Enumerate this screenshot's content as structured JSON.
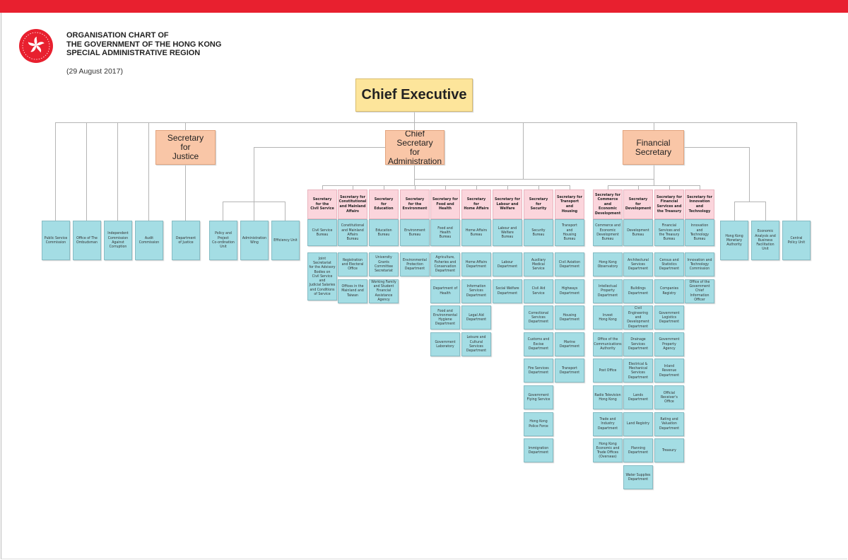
{
  "header": {
    "title_lines": [
      "ORGANISATION CHART OF",
      "THE GOVERNMENT OF THE HONG KONG",
      "SPECIAL ADMINISTRATIVE REGION"
    ],
    "date": "(29 August 2017)",
    "logo_text": "HONG KONG"
  },
  "colors": {
    "top_bar": "#e8202f",
    "chief_executive": "#fde59b",
    "principal_officials": "#f9c6a7",
    "secretaries": "#fbd5dc",
    "departments": "#a4dde4"
  },
  "chief_executive": "Chief Executive",
  "principal_officials": {
    "sj": "Secretary\nfor\nJustice",
    "cs": "Chief Secretary\nfor\nAdministration",
    "fs": "Financial\nSecretary"
  },
  "independent": [
    "Public Service\nCommission",
    "Office of The\nOmbudsman",
    "Independent\nCommission\nAgainst\nCorruption",
    "Audit\nCommission"
  ],
  "sj_units": [
    "Department\nof Justice"
  ],
  "cs_units": [
    "Policy and\nProject\nCo-ordination\nUnit",
    "Administration\nWing",
    "Efficiency Unit"
  ],
  "fs_units": [
    "Hong Kong\nMonetary\nAuthority",
    "Economic\nAnalysis and\nBusiness\nFacilitation Unit"
  ],
  "ce_units": [
    "Central\nPolicy Unit"
  ],
  "cs_bureaux": [
    {
      "secretary": "Secretary\nfor the\nCivil Service",
      "bureau": "Civil Service\nBureau",
      "departments": [
        "Joint\nSecretariat\nfor the Advisory\nBodies on\nCivil Service and\nJudicial Salaries\nand Conditions\nof Service"
      ]
    },
    {
      "secretary": "Secretary for\nConstitutional\nand Mainland\nAffairs",
      "bureau": "Constitutional\nand Mainland\nAffairs\nBureau",
      "departments": [
        "Registration\nand Electoral\nOffice",
        "Offices in the\nMainland and\nTaiwan"
      ]
    },
    {
      "secretary": "Secretary\nfor\nEducation",
      "bureau": "Education\nBureau",
      "departments": [
        "University\nGrants\nCommittee\nSecretariat",
        "Working Family\nand Student\nFinancial\nAssistance Agency"
      ]
    },
    {
      "secretary": "Secretary\nfor the\nEnvironment",
      "bureau": "Environment\nBureau",
      "departments": [
        "Environmental\nProtection\nDepartment"
      ]
    },
    {
      "secretary": "Secretary for\nFood and\nHealth",
      "bureau": "Food and\nHealth\nBureau",
      "departments": [
        "Agriculture,\nFisheries and\nConservation\nDepartment",
        "Department of\nHealth",
        "Food and\nEnvironmental\nHygiene\nDepartment",
        "Government\nLaboratory"
      ]
    },
    {
      "secretary": "Secretary\nfor\nHome Affairs",
      "bureau": "Home Affairs\nBureau",
      "departments": [
        "Home Affairs\nDepartment",
        "Information\nServices\nDepartment",
        "Legal Aid\nDepartment",
        "Leisure and\nCultural Services\nDepartment"
      ]
    },
    {
      "secretary": "Secretary for\nLabour and\nWelfare",
      "bureau": "Labour and\nWelfare\nBureau",
      "departments": [
        "Labour\nDepartment",
        "Social Welfare\nDepartment"
      ]
    },
    {
      "secretary": "Secretary\nfor\nSecurity",
      "bureau": "Security\nBureau",
      "departments": [
        "Auxiliary\nMedical\nService",
        "Civil Aid\nService",
        "Correctional\nServices\nDepartment",
        "Customs and\nExcise\nDepartment",
        "Fire Services\nDepartment",
        "Government\nFlying Service",
        "Hong Kong\nPolice Force",
        "Immigration\nDepartment"
      ]
    },
    {
      "secretary": "Secretary for\nTransport\nand\nHousing",
      "bureau": "Transport\nand\nHousing\nBureau",
      "departments": [
        "Civil Aviation\nDepartment",
        "Highways\nDepartment",
        "Housing\nDepartment",
        "Marine\nDepartment",
        "Transport\nDepartment"
      ]
    }
  ],
  "fs_bureaux": [
    {
      "secretary": "Secretary for\nCommerce and\nEconomic\nDevelopment",
      "bureau": "Commerce and\nEconomic\nDevelopment\nBureau",
      "departments": [
        "Hong Kong\nObservatory",
        "Intellectual\nProperty\nDepartment",
        "Invest\nHong Kong",
        "Office of the\nCommunications\nAuthority",
        "Post Office",
        "Radio Television\nHong Kong",
        "Trade and\nIndustry\nDepartment",
        "Hong Kong\nEconomic and\nTrade Offices\n(Overseas)"
      ]
    },
    {
      "secretary": "Secretary\nfor\nDevelopment",
      "bureau": "Development\nBureau",
      "departments": [
        "Architectural\nServices\nDepartment",
        "Buildings\nDepartment",
        "Civil\nEngineering and\nDevelopment\nDepartment",
        "Drainage\nServices\nDepartment",
        "Electrical &\nMechanical\nServices\nDepartment",
        "Lands\nDepartment",
        "Land Registry",
        "Planning\nDepartment",
        "Water Supplies\nDepartment"
      ]
    },
    {
      "secretary": "Secretary for\nFinancial\nServices and\nthe Treasury",
      "bureau": "Financial\nServices and\nthe Treasury\nBureau",
      "departments": [
        "Census and\nStatistics\nDepartment",
        "Companies\nRegistry",
        "Government\nLogistics\nDepartment",
        "Government\nProperty\nAgency",
        "Inland\nRevenue\nDepartment",
        "Official\nReceiver's\nOffice",
        "Rating and\nValuation\nDepartment",
        "Treasury"
      ]
    },
    {
      "secretary": "Secretary for\nInnovation\nand\nTechnology",
      "bureau": "Innovation\nand\nTechnology\nBureau",
      "departments": [
        "Innovation and\nTechnology\nCommission",
        "Office of the\nGovernment\nChief Information\nOfficer"
      ]
    }
  ]
}
